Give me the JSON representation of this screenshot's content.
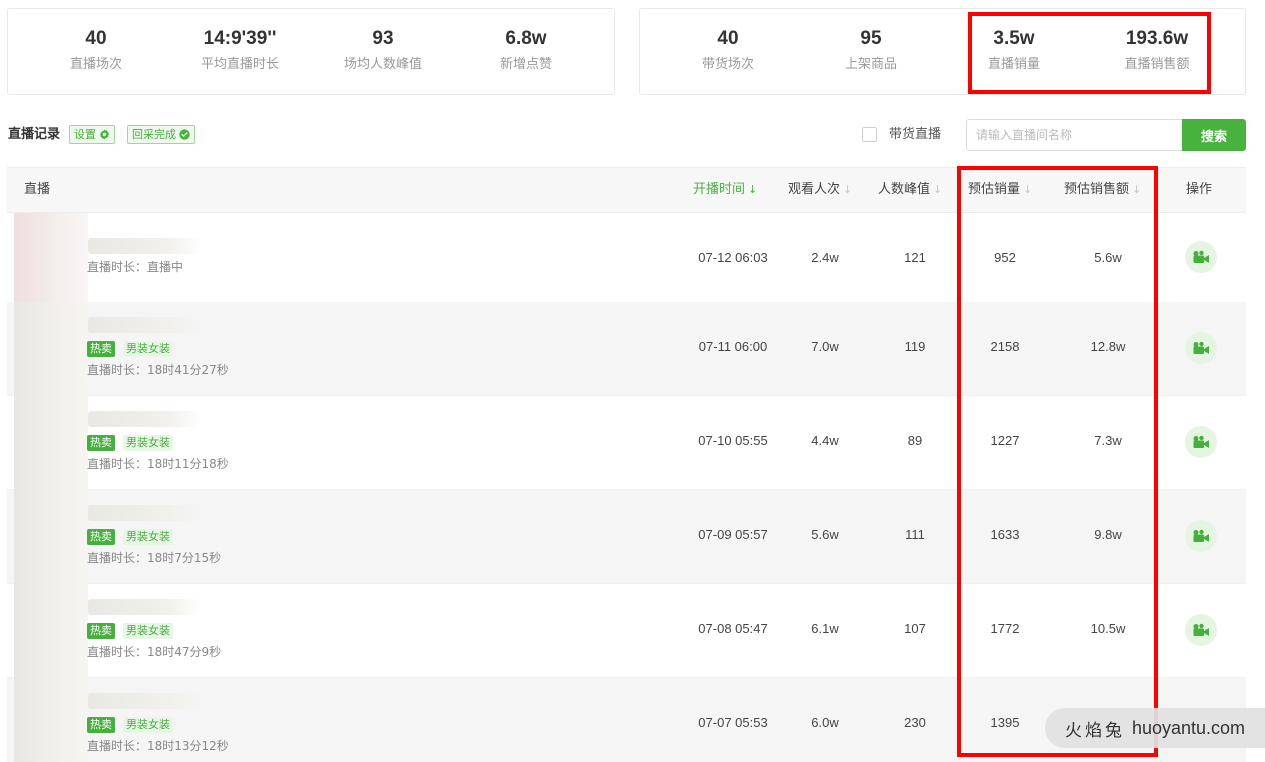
{
  "summary_left": [
    {
      "value": "40",
      "label": "直播场次"
    },
    {
      "value": "14:9'39''",
      "label": "平均直播时长"
    },
    {
      "value": "93",
      "label": "场均人数峰值"
    },
    {
      "value": "6.8w",
      "label": "新增点赞"
    }
  ],
  "summary_right": [
    {
      "value": "40",
      "label": "带货场次"
    },
    {
      "value": "95",
      "label": "上架商品"
    },
    {
      "value": "3.5w",
      "label": "直播销量"
    },
    {
      "value": "193.6w",
      "label": "直播销售额"
    }
  ],
  "toolbar": {
    "title": "直播记录",
    "settings_tag": "设置",
    "status_tag": "回采完成",
    "checkbox_label": "带货直播",
    "search_placeholder": "请输入直播间名称",
    "search_button": "搜索"
  },
  "table": {
    "headers": {
      "live": "直播",
      "start_time": "开播时间",
      "views": "观看人次",
      "peak": "人数峰值",
      "est_sales": "预估销量",
      "est_revenue": "预估销售额",
      "actions": "操作"
    },
    "sort_icon": "↓",
    "rows": [
      {
        "hot": "",
        "category": "",
        "duration": "直播时长：直播中",
        "start": "07-12 06:03",
        "views": "2.4w",
        "peak": "121",
        "sales": "952",
        "revenue": "5.6w"
      },
      {
        "hot": "热卖",
        "category": "男装女装",
        "duration": "直播时长：18时41分27秒",
        "start": "07-11 06:00",
        "views": "7.0w",
        "peak": "119",
        "sales": "2158",
        "revenue": "12.8w"
      },
      {
        "hot": "热卖",
        "category": "男装女装",
        "duration": "直播时长：18时11分18秒",
        "start": "07-10 05:55",
        "views": "4.4w",
        "peak": "89",
        "sales": "1227",
        "revenue": "7.3w"
      },
      {
        "hot": "热卖",
        "category": "男装女装",
        "duration": "直播时长：18时7分15秒",
        "start": "07-09 05:57",
        "views": "5.6w",
        "peak": "111",
        "sales": "1633",
        "revenue": "9.8w"
      },
      {
        "hot": "热卖",
        "category": "男装女装",
        "duration": "直播时长：18时47分9秒",
        "start": "07-08 05:47",
        "views": "6.1w",
        "peak": "107",
        "sales": "1772",
        "revenue": "10.5w"
      },
      {
        "hot": "热卖",
        "category": "男装女装",
        "duration": "直播时长：18时13分12秒",
        "start": "07-07 05:53",
        "views": "6.0w",
        "peak": "230",
        "sales": "1395",
        "revenue": ""
      }
    ]
  },
  "watermark": {
    "cn": "火焰兔",
    "en": "huoyantu.com"
  },
  "colors": {
    "accent": "#48b23f",
    "highlight": "#ff0000",
    "row_alt": "#f5f5f5"
  },
  "icons": {
    "settings": "gear-icon",
    "status": "check-circle-icon",
    "action": "video-camera-icon"
  }
}
